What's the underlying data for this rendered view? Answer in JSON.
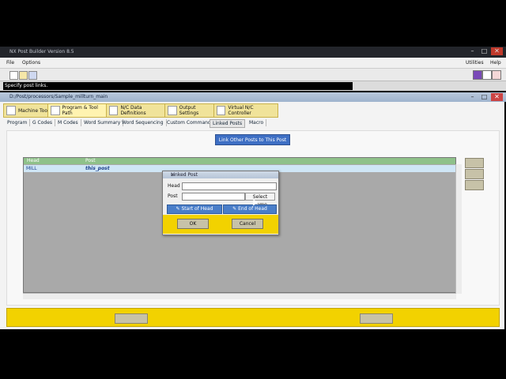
{
  "app": {
    "title": "NX Post Builder Version 8.5",
    "menu": [
      "File",
      "Options",
      "Utilities",
      "Help"
    ]
  },
  "status": {
    "text": "Specify post links."
  },
  "inner_window": {
    "title": "D:/Post/processors/Sample_millturn_main"
  },
  "tabs": [
    {
      "label": "Machine Tool",
      "icon": "machine-tool-icon"
    },
    {
      "label": "Program & Tool Path",
      "icon": "program-toolpath-icon"
    },
    {
      "label": "N/C Data Definitions",
      "icon": "nc-data-icon"
    },
    {
      "label": "Output Settings",
      "icon": "output-settings-icon"
    },
    {
      "label": "Virtual N/C Controller",
      "icon": "virtual-nc-icon"
    }
  ],
  "subtabs": [
    "Program",
    "G Codes",
    "M Codes",
    "Word Summary",
    "Word Sequencing",
    "Custom Command",
    "Linked Posts",
    "Macro"
  ],
  "link_button": {
    "label": "Link Other Posts to This Post"
  },
  "grid": {
    "columns": [
      "Head",
      "Post"
    ],
    "rows": [
      {
        "head": "MILL",
        "post": "this_post"
      }
    ]
  },
  "dialog": {
    "title": "Linked Post",
    "head_label": "Head",
    "post_label": "Post",
    "head_value": "",
    "post_value": "",
    "select_name_label": "Select Name",
    "start_of_head_label": "Start of Head",
    "end_of_head_label": "End of Head",
    "ok_label": "OK",
    "cancel_label": "Cancel"
  },
  "colors": {
    "accent_yellow": "#f2d200",
    "button_blue": "#3e6fc4",
    "grid_header_green": "#8fc18a"
  }
}
